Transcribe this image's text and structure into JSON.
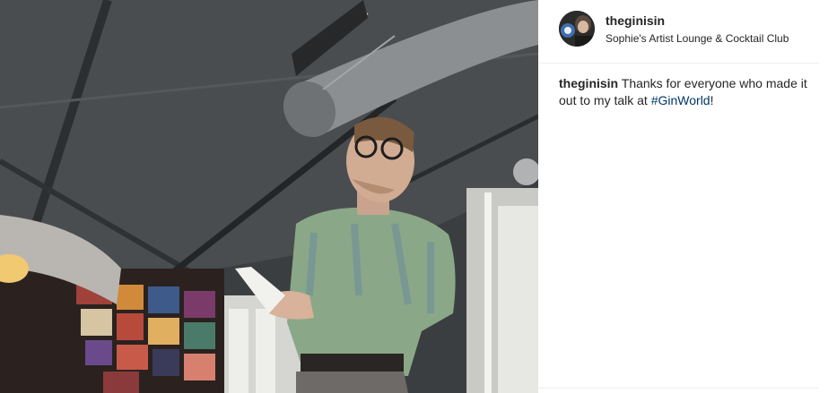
{
  "post": {
    "username": "theginisin",
    "location": "Sophie's Artist Lounge & Cocktail Club",
    "caption": {
      "username": "theginisin",
      "text_before": " Thanks for everyone who made it out to my talk at ",
      "hashtag": "#GinWorld",
      "text_after": "!"
    }
  },
  "colors": {
    "text": "#262626",
    "hashtag": "#003569",
    "divider": "#efefef"
  },
  "icons": {
    "avatar": "profile-photo"
  }
}
